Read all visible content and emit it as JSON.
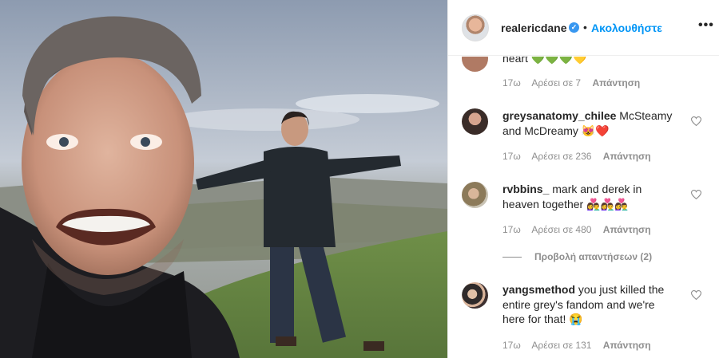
{
  "post": {
    "username": "realericdane",
    "follow_label": "Ακολουθήστε",
    "dot": "•",
    "verified_glyph": "✓",
    "more_glyph": "•••"
  },
  "comments": [
    {
      "username": "",
      "text": "heart",
      "emoji": "💚💚💚💛",
      "age": "17ω",
      "likes": "Αρέσει σε 7",
      "reply": "Απάντηση"
    },
    {
      "username": "greysanatomy_chilee",
      "text": "McSteamy and McDreamy",
      "emoji": "😻❤️",
      "age": "17ω",
      "likes": "Αρέσει σε 236",
      "reply": "Απάντηση"
    },
    {
      "username": "rvbbins_",
      "text": "mark and derek in heaven together",
      "emoji": "👩‍❤️‍👨👩‍❤️‍👨👩‍❤️‍👨",
      "age": "17ω",
      "likes": "Αρέσει σε 480",
      "reply": "Απάντηση"
    },
    {
      "username": "yangsmethod",
      "text": "you just killed the entire grey's fandom and we're here for that!",
      "emoji": "😭",
      "age": "17ω",
      "likes": "Αρέσει σε 131",
      "reply": "Απάντηση"
    }
  ],
  "view_replies": "Προβολή απαντήσεων (2)",
  "colors": {
    "link": "#0095f6",
    "muted": "#8e8e8e",
    "text": "#262626",
    "verified": "#3897f0"
  },
  "icons": [
    "verified-badge-icon",
    "more-options-icon",
    "heart-icon"
  ]
}
